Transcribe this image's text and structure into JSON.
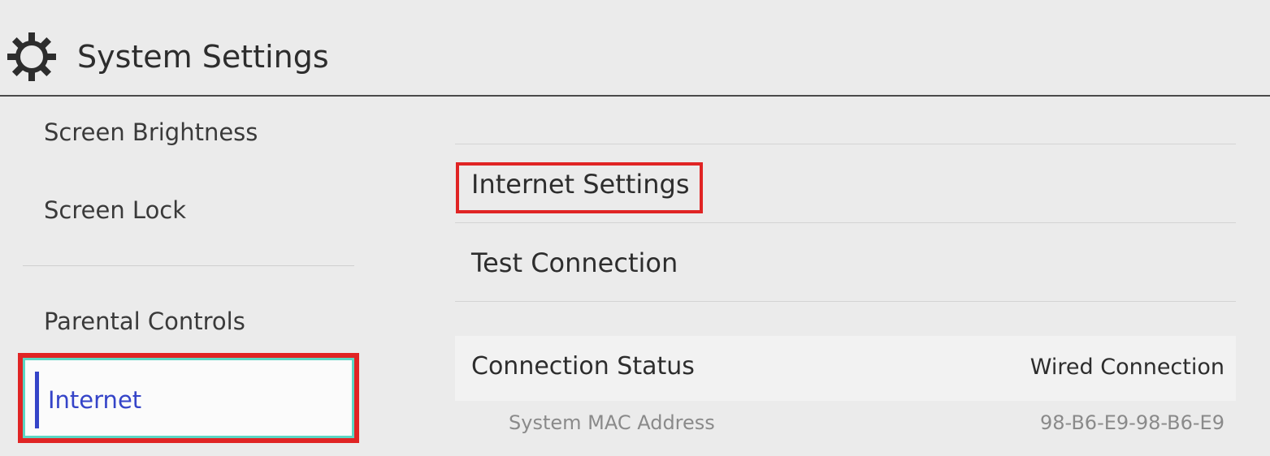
{
  "header": {
    "icon": "gear-icon",
    "title": "System Settings"
  },
  "sidebar": {
    "items": [
      {
        "label": "Screen Brightness"
      },
      {
        "label": "Screen Lock"
      },
      {
        "label": "Parental Controls"
      },
      {
        "label": "Internet",
        "selected": true
      }
    ],
    "accent_color": "#3544c8"
  },
  "main": {
    "menu": [
      {
        "label": "Internet Settings",
        "highlighted": true
      },
      {
        "label": "Test Connection"
      }
    ],
    "connection_status": {
      "label": "Connection Status",
      "value": "Wired Connection"
    },
    "mac_address": {
      "label": "System MAC Address",
      "value": "98-B6-E9-98-B6-E9"
    }
  },
  "colors": {
    "highlight_border": "#e02424",
    "focus_border": "#5ad6c4",
    "selected_text": "#3544c8"
  }
}
